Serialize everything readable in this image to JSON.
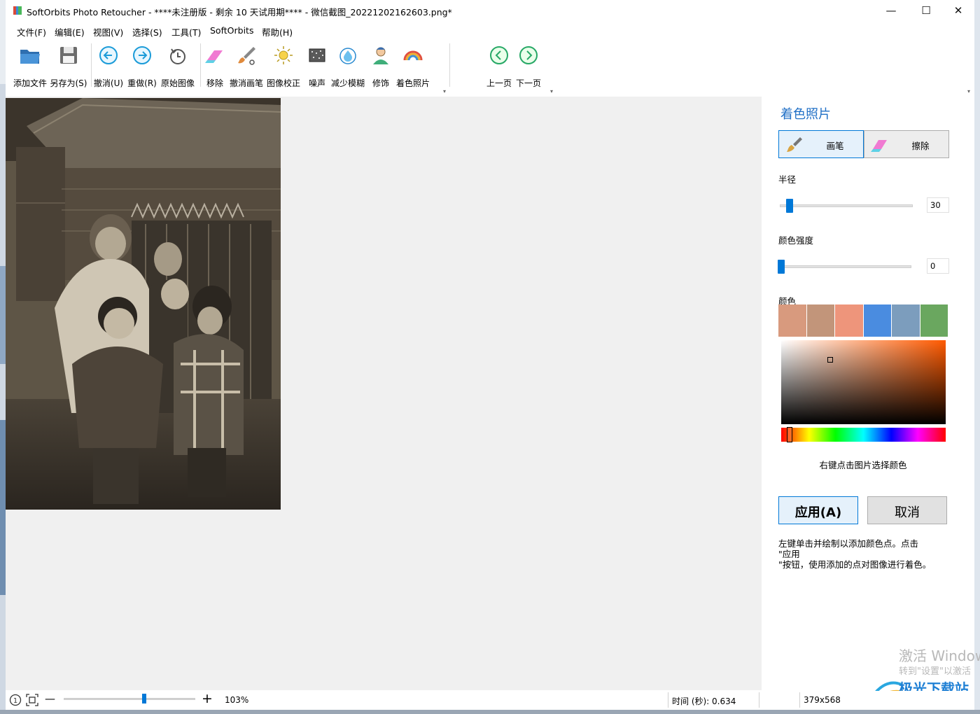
{
  "window": {
    "title": "SoftOrbits Photo Retoucher - ****未注册版 - 剩余 10 天试用期**** - 微信截图_20221202162603.png*",
    "minimize": "—",
    "maximize": "☐",
    "close": "✕"
  },
  "menu": [
    "文件(F)",
    "编辑(E)",
    "视图(V)",
    "选择(S)",
    "工具(T)",
    "SoftOrbits",
    "帮助(H)"
  ],
  "toolbar": {
    "add_file": "添加文件",
    "save_as": "另存为(S)",
    "undo": "撤消(U)",
    "redo": "重做(R)",
    "original": "原始图像",
    "remove": "移除",
    "undo_brush": "撤消画笔",
    "correct": "图像校正",
    "noise": "噪声",
    "deblur": "减少模糊",
    "retouch": "修饰",
    "colorize": "着色照片",
    "prev": "上一页",
    "next": "下一页"
  },
  "panel": {
    "title": "着色照片",
    "brush": "画笔",
    "erase": "擦除",
    "radius_label": "半径",
    "radius_value": "30",
    "radius_fraction": 0.07,
    "intensity_label": "颜色强度",
    "intensity_value": "0",
    "intensity_fraction": 0.0,
    "color_label": "颜色",
    "swatches": [
      "#d89a7e",
      "#c2957a",
      "#ee957b",
      "#4a8ce0",
      "#7c9dbd",
      "#6aa75f"
    ],
    "picker_hue_color": "#ff5a00",
    "hint": "右键点击图片选择颜色",
    "apply": "应用(A)",
    "cancel": "取消",
    "description": "左键单击并绘制以添加颜色点。点击\n\"应用\n\"按钮，使用添加的点对图像进行着色。"
  },
  "status": {
    "zoom": "103%",
    "zoom_minus": "—",
    "zoom_plus": "+",
    "time": "时间 (秒): 0.634",
    "size": "379x568"
  },
  "watermark": {
    "line1": "激活 Windows",
    "line2": "转到\"设置\"以激活",
    "brand": "极光下载站"
  },
  "colors": {
    "accent": "#0078d7",
    "panel_title": "#1f6fc6",
    "canvas_bg": "#f0f0f0"
  }
}
